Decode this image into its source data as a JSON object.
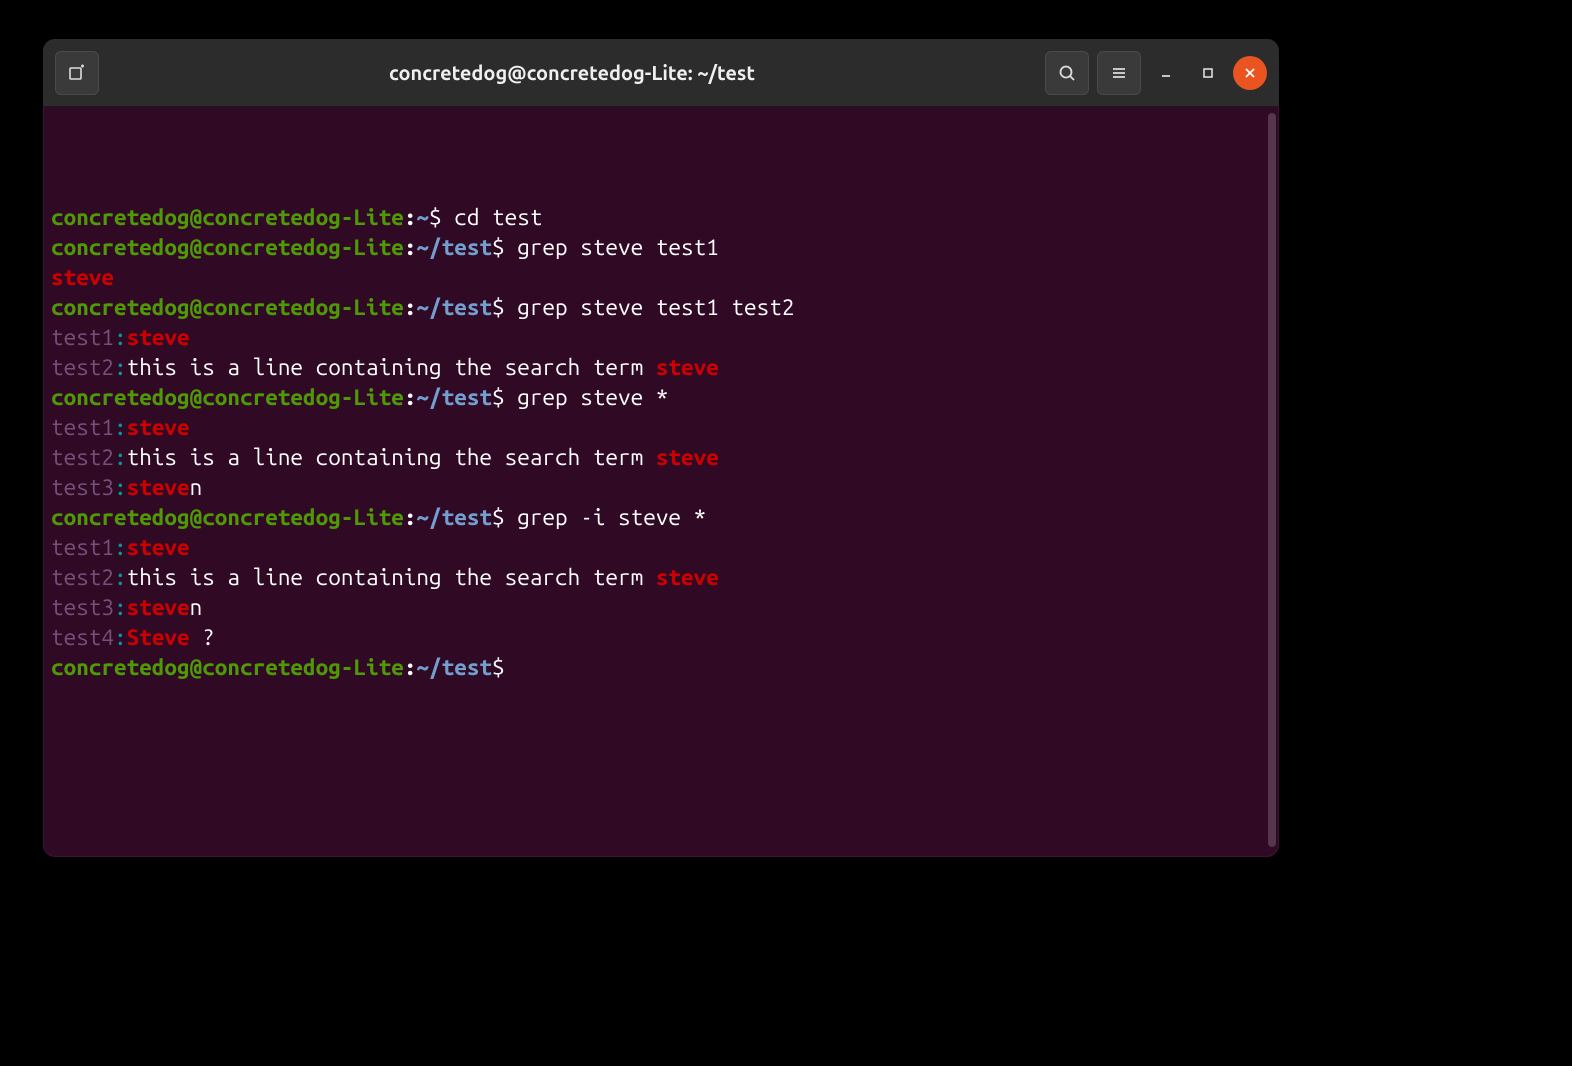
{
  "titlebar": {
    "title": "concretedog@concretedog-Lite: ~/test"
  },
  "colors": {
    "bg_terminal": "#300a24",
    "bg_titlebar": "#2c2c2c",
    "accent_close": "#e95420",
    "prompt_user": "#4e9a06",
    "prompt_path": "#729fcf",
    "grep_file": "#75507b",
    "grep_sep": "#06989a",
    "grep_match": "#cc0000"
  },
  "lines": [
    {
      "type": "cmd",
      "user": "concretedog@concretedog-Lite",
      "sep": ":",
      "path": "~",
      "dollar": "$ ",
      "command": "cd test"
    },
    {
      "type": "cmd",
      "user": "concretedog@concretedog-Lite",
      "sep": ":",
      "path": "~/test",
      "dollar": "$ ",
      "command": "grep steve test1"
    },
    {
      "type": "out",
      "segments": [
        {
          "c": "match",
          "t": "steve"
        }
      ]
    },
    {
      "type": "cmd",
      "user": "concretedog@concretedog-Lite",
      "sep": ":",
      "path": "~/test",
      "dollar": "$ ",
      "command": "grep steve test1 test2"
    },
    {
      "type": "out",
      "segments": [
        {
          "c": "filename",
          "t": "test1"
        },
        {
          "c": "cyan",
          "t": ":"
        },
        {
          "c": "match",
          "t": "steve"
        }
      ]
    },
    {
      "type": "out",
      "segments": [
        {
          "c": "filename",
          "t": "test2"
        },
        {
          "c": "cyan",
          "t": ":"
        },
        {
          "c": "txt",
          "t": "this is a line containing the search term "
        },
        {
          "c": "match",
          "t": "steve"
        }
      ]
    },
    {
      "type": "cmd",
      "user": "concretedog@concretedog-Lite",
      "sep": ":",
      "path": "~/test",
      "dollar": "$ ",
      "command": "grep steve *"
    },
    {
      "type": "out",
      "segments": [
        {
          "c": "filename",
          "t": "test1"
        },
        {
          "c": "cyan",
          "t": ":"
        },
        {
          "c": "match",
          "t": "steve"
        }
      ]
    },
    {
      "type": "out",
      "segments": [
        {
          "c": "filename",
          "t": "test2"
        },
        {
          "c": "cyan",
          "t": ":"
        },
        {
          "c": "txt",
          "t": "this is a line containing the search term "
        },
        {
          "c": "match",
          "t": "steve"
        }
      ]
    },
    {
      "type": "out",
      "segments": [
        {
          "c": "filename",
          "t": "test3"
        },
        {
          "c": "cyan",
          "t": ":"
        },
        {
          "c": "match",
          "t": "steve"
        },
        {
          "c": "txt",
          "t": "n"
        }
      ]
    },
    {
      "type": "cmd",
      "user": "concretedog@concretedog-Lite",
      "sep": ":",
      "path": "~/test",
      "dollar": "$ ",
      "command": "grep -i steve *"
    },
    {
      "type": "out",
      "segments": [
        {
          "c": "filename",
          "t": "test1"
        },
        {
          "c": "cyan",
          "t": ":"
        },
        {
          "c": "match",
          "t": "steve"
        }
      ]
    },
    {
      "type": "out",
      "segments": [
        {
          "c": "filename",
          "t": "test2"
        },
        {
          "c": "cyan",
          "t": ":"
        },
        {
          "c": "txt",
          "t": "this is a line containing the search term "
        },
        {
          "c": "match",
          "t": "steve"
        }
      ]
    },
    {
      "type": "out",
      "segments": [
        {
          "c": "filename",
          "t": "test3"
        },
        {
          "c": "cyan",
          "t": ":"
        },
        {
          "c": "match",
          "t": "steve"
        },
        {
          "c": "txt",
          "t": "n"
        }
      ]
    },
    {
      "type": "out",
      "segments": [
        {
          "c": "filename",
          "t": "test4"
        },
        {
          "c": "cyan",
          "t": ":"
        },
        {
          "c": "match",
          "t": "Steve"
        },
        {
          "c": "txt",
          "t": " ?"
        }
      ]
    },
    {
      "type": "cmd",
      "user": "concretedog@concretedog-Lite",
      "sep": ":",
      "path": "~/test",
      "dollar": "$ ",
      "command": ""
    }
  ]
}
